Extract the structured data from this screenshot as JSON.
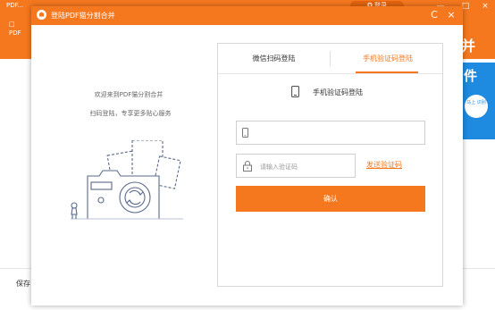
{
  "background_app": {
    "title": "PDF...",
    "vip_pill": "✪ 登录",
    "left_button": [
      "□",
      "PDF"
    ],
    "right_big_text": "并",
    "right_blue_text": "件",
    "right_badge_text": "马上\n识别",
    "save_label": "保存",
    "controls": {
      "minimize": "—",
      "maximize": "□",
      "close": "×"
    }
  },
  "dialog": {
    "title": "登陆PDF猫分割合并",
    "refresh_icon": "C",
    "close_icon": "×"
  },
  "left_pane": {
    "welcome": "欢迎来到PDF猫分割合并",
    "slogan": "扫码登陆，专享更多贴心服务"
  },
  "login_panel": {
    "tabs": [
      {
        "label": "微信扫码登陆",
        "active": false
      },
      {
        "label": "手机验证码登陆",
        "active": true
      }
    ],
    "phone_heading": "手机验证码登陆",
    "phone_input": {
      "value": "",
      "placeholder": ""
    },
    "code_input": {
      "value": "",
      "placeholder": "请输入验证码"
    },
    "send_code_label": "发送验证码",
    "confirm_label": "确认"
  },
  "colors": {
    "accent": "#f5781e",
    "blue": "#1e8be0",
    "border": "#cfcfcf"
  }
}
